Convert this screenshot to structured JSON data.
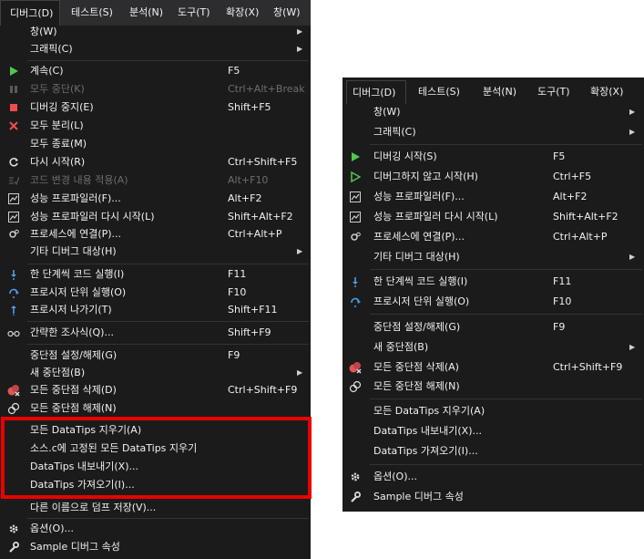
{
  "left_menu": {
    "menubar": [
      "디버그(D)",
      "테스트(S)",
      "분석(N)",
      "도구(T)",
      "확장(X)",
      "창(W)"
    ],
    "items": [
      {
        "label": "창(W)",
        "submenu": true
      },
      {
        "label": "그래픽(C)",
        "submenu": true
      },
      {
        "label": "계속(C)",
        "shortcut": "F5",
        "icon": "continue-icon"
      },
      {
        "label": "모두 중단(K)",
        "shortcut": "Ctrl+Alt+Break",
        "icon": "pause-icon",
        "disabled": true
      },
      {
        "label": "디버깅 중지(E)",
        "shortcut": "Shift+F5",
        "icon": "stop-icon"
      },
      {
        "label": "모두 분리(L)",
        "icon": "detach-icon"
      },
      {
        "label": "모두 종료(M)"
      },
      {
        "label": "다시 시작(R)",
        "shortcut": "Ctrl+Shift+F5",
        "icon": "restart-icon"
      },
      {
        "label": "코드 변경 내용 적용(A)",
        "shortcut": "Alt+F10",
        "icon": "apply-code-changes-icon",
        "disabled": true
      },
      {
        "label": "성능 프로파일러(F)...",
        "shortcut": "Alt+F2",
        "icon": "profiler-icon"
      },
      {
        "label": "성능 프로파일러 다시 시작(L)",
        "shortcut": "Shift+Alt+F2",
        "icon": "profiler-icon"
      },
      {
        "label": "프로세스에 연결(P)...",
        "shortcut": "Ctrl+Alt+P",
        "icon": "attach-process-icon"
      },
      {
        "label": "기타 디버그 대상(H)",
        "submenu": true
      },
      {
        "label": "한 단계씩 코드 실행(I)",
        "shortcut": "F11",
        "icon": "step-into-icon"
      },
      {
        "label": "프로시저 단위 실행(O)",
        "shortcut": "F10",
        "icon": "step-over-icon"
      },
      {
        "label": "프로시저 나가기(T)",
        "shortcut": "Shift+F11",
        "icon": "step-out-icon"
      },
      {
        "label": "간략한 조사식(Q)...",
        "shortcut": "Shift+F9",
        "icon": "quickwatch-icon"
      },
      {
        "label": "중단점 설정/해제(G)",
        "shortcut": "F9"
      },
      {
        "label": "새 중단점(B)",
        "submenu": true
      },
      {
        "label": "모든 중단점 삭제(D)",
        "shortcut": "Ctrl+Shift+F9",
        "icon": "delete-breakpoints-icon"
      },
      {
        "label": "모든 중단점 해제(N)",
        "icon": "disable-breakpoints-icon"
      },
      {
        "label": "모든 DataTips 지우기(A)"
      },
      {
        "label": "소스.c에 고정된 모든 DataTips 지우기"
      },
      {
        "label": "DataTips 내보내기(X)..."
      },
      {
        "label": "DataTips 가져오기(I)..."
      },
      {
        "label": "다른 이름으로 덤프 저장(V)..."
      },
      {
        "label": "옵션(O)...",
        "icon": "options-gear-icon"
      },
      {
        "label": "Sample 디버그 속성",
        "icon": "wrench-icon"
      }
    ]
  },
  "right_menu": {
    "menubar": [
      "디버그(D)",
      "테스트(S)",
      "분석(N)",
      "도구(T)",
      "확장(X)"
    ],
    "items": [
      {
        "label": "창(W)",
        "submenu": true
      },
      {
        "label": "그래픽(C)",
        "submenu": true
      },
      {
        "label": "디버깅 시작(S)",
        "shortcut": "F5",
        "icon": "start-debugging-icon"
      },
      {
        "label": "디버그하지 않고 시작(H)",
        "shortcut": "Ctrl+F5",
        "icon": "start-without-debugging-icon"
      },
      {
        "label": "성능 프로파일러(F)...",
        "shortcut": "Alt+F2",
        "icon": "profiler-icon"
      },
      {
        "label": "성능 프로파일러 다시 시작(L)",
        "shortcut": "Shift+Alt+F2",
        "icon": "profiler-icon"
      },
      {
        "label": "프로세스에 연결(P)...",
        "shortcut": "Ctrl+Alt+P",
        "icon": "attach-process-icon"
      },
      {
        "label": "기타 디버그 대상(H)",
        "submenu": true
      },
      {
        "label": "한 단계씩 코드 실행(I)",
        "shortcut": "F11",
        "icon": "step-into-icon"
      },
      {
        "label": "프로시저 단위 실행(O)",
        "shortcut": "F10",
        "icon": "step-over-icon"
      },
      {
        "label": "중단점 설정/해제(G)",
        "shortcut": "F9"
      },
      {
        "label": "새 중단점(B)",
        "submenu": true
      },
      {
        "label": "모든 중단점 삭제(A)",
        "shortcut": "Ctrl+Shift+F9",
        "icon": "delete-breakpoints-icon"
      },
      {
        "label": "모든 중단점 해제(N)",
        "icon": "disable-breakpoints-icon"
      },
      {
        "label": "모든 DataTips 지우기(A)"
      },
      {
        "label": "DataTips 내보내기(X)..."
      },
      {
        "label": "DataTips 가져오기(I)..."
      },
      {
        "label": "옵션(O)...",
        "icon": "options-gear-icon"
      },
      {
        "label": "Sample 디버그 속성",
        "icon": "wrench-icon"
      }
    ]
  },
  "colors": {
    "menu_bg": "#1b1b1c",
    "menubar_bg": "#2d2d30",
    "text": "#f1f1f1",
    "disabled_text": "#6d6d6d",
    "highlight_border": "#e80000"
  }
}
